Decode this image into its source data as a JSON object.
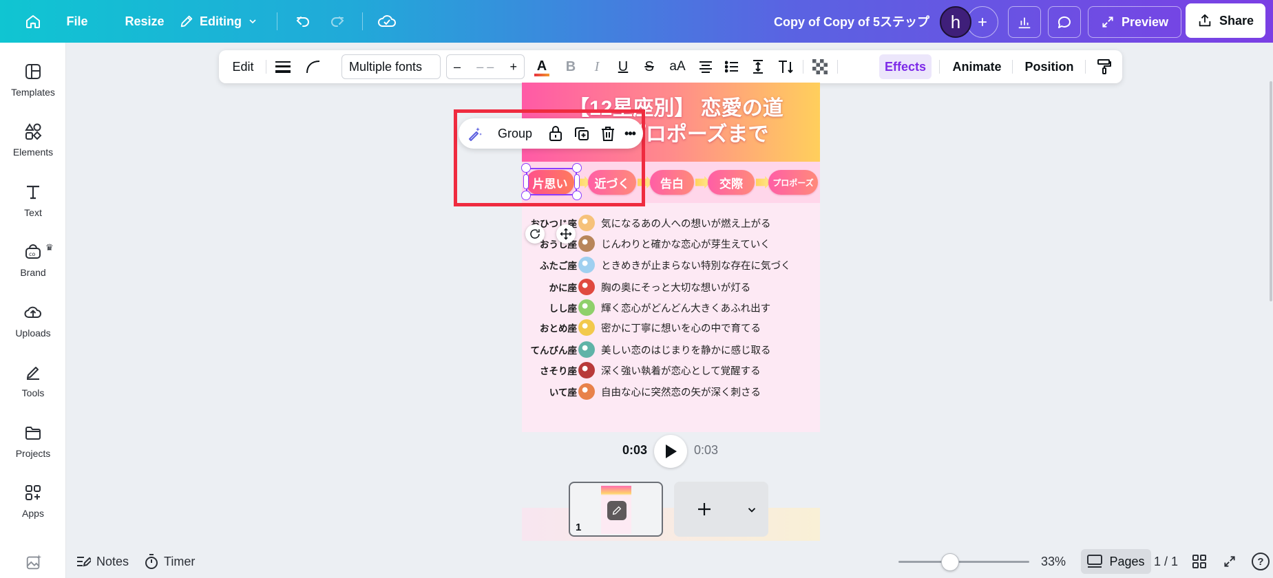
{
  "topbar": {
    "file_label": "File",
    "resize_label": "Resize",
    "editing_label": "Editing",
    "document_title": "Copy of Copy of 5ステップ",
    "avatar_initial": "h",
    "preview_label": "Preview",
    "share_label": "Share",
    "icons": [
      "home-icon",
      "pencil-icon",
      "chevron-down-icon",
      "undo-icon",
      "redo-icon",
      "cloud-check-icon",
      "plus-icon",
      "analytics-icon",
      "comment-icon",
      "expand-icon",
      "share-icon"
    ],
    "gradient_colors": [
      "#10c5d2",
      "#5a63e2",
      "#7b3fe4"
    ]
  },
  "sidebar": {
    "items": [
      {
        "label": "Templates",
        "icon": "templates-icon"
      },
      {
        "label": "Elements",
        "icon": "elements-icon"
      },
      {
        "label": "Text",
        "icon": "text-icon"
      },
      {
        "label": "Brand",
        "icon": "brand-icon"
      },
      {
        "label": "Uploads",
        "icon": "uploads-icon"
      },
      {
        "label": "Tools",
        "icon": "tools-icon"
      },
      {
        "label": "Projects",
        "icon": "projects-icon"
      },
      {
        "label": "Apps",
        "icon": "apps-icon"
      }
    ]
  },
  "text_toolbar": {
    "edit_label": "Edit",
    "font_name": "Multiple fonts",
    "font_size_value": "– –",
    "minus": "–",
    "plus": "+",
    "case_label": "aA",
    "effects_label": "Effects",
    "animate_label": "Animate",
    "position_label": "Position",
    "accent_color": "#7d2ae8"
  },
  "context_bar": {
    "group_label": "Group",
    "more_label": "•••"
  },
  "design": {
    "title_line1": "【12星座別】 恋愛の道",
    "title_line2": "から プロポーズまで",
    "steps": [
      "片思い",
      "近づく",
      "告白",
      "交際",
      "プロポーズ"
    ],
    "rows": [
      {
        "sign": "おひつじ座",
        "text": "気になるあの人への想いが燃え上がる",
        "color": "#f6c27a"
      },
      {
        "sign": "おうし座",
        "text": "じんわりと確かな恋心が芽生えていく",
        "color": "#b8865a"
      },
      {
        "sign": "ふたご座",
        "text": "ときめきが止まらない特別な存在に気づく",
        "color": "#9fd0f0"
      },
      {
        "sign": "かに座",
        "text": "胸の奥にそっと大切な想いが灯る",
        "color": "#e0493f"
      },
      {
        "sign": "しし座",
        "text": "輝く恋心がどんどん大きくあふれ出す",
        "color": "#8fd06b"
      },
      {
        "sign": "おとめ座",
        "text": "密かに丁寧に想いを心の中で育てる",
        "color": "#f2c94c"
      },
      {
        "sign": "てんびん座",
        "text": "美しい恋のはじまりを静かに感じ取る",
        "color": "#5fb3a7"
      },
      {
        "sign": "さそり座",
        "text": "深く強い執着が恋心として覚醒する",
        "color": "#b83a3a"
      },
      {
        "sign": "いて座",
        "text": "自由な心に突然恋の矢が深く刺さる",
        "color": "#e8824a"
      }
    ]
  },
  "playback": {
    "current_time": "0:03",
    "total_time": "0:03"
  },
  "pages_strip": {
    "page_number": "1"
  },
  "bottombar": {
    "notes_label": "Notes",
    "timer_label": "Timer",
    "zoom_value": "33%",
    "zoom_fraction": 0.33,
    "pages_label": "Pages",
    "page_count": "1 / 1",
    "help_label": "?"
  }
}
